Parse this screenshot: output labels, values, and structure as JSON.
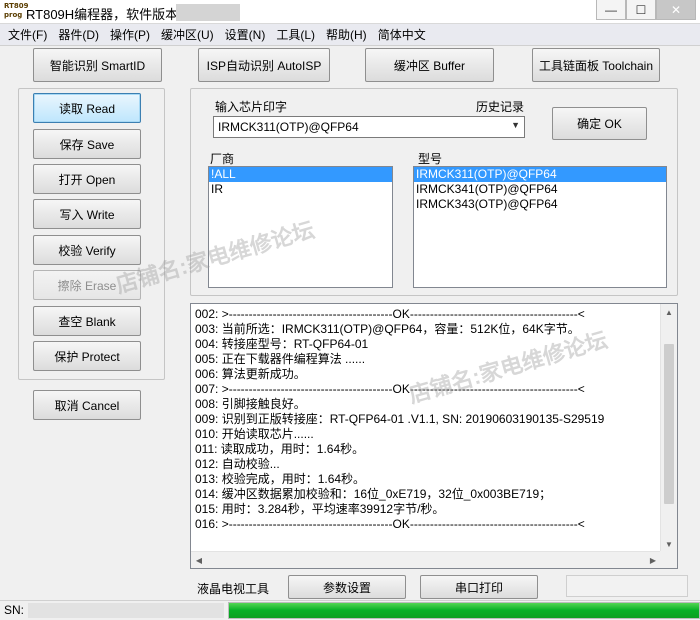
{
  "window": {
    "title": "RT809H编程器，软件版本：",
    "app_icon_text": "RT809 prog",
    "minimize_glyph": "—",
    "maximize_glyph": "☐",
    "close_glyph": "✕"
  },
  "menu": [
    "文件(F)",
    "器件(D)",
    "操作(P)",
    "缓冲区(U)",
    "设置(N)",
    "工具(L)",
    "帮助(H)",
    "简体中文"
  ],
  "top_buttons": {
    "smart_id": "智能识别 SmartID",
    "isp_auto": "ISP自动识别 AutoISP",
    "buffer": "缓冲区 Buffer",
    "toolchain": "工具链面板 Toolchain"
  },
  "side_buttons": {
    "read": "读取 Read",
    "save": "保存 Save",
    "open": "打开 Open",
    "write": "写入 Write",
    "verify": "校验 Verify",
    "erase": "擦除 Erase",
    "blank": "查空 Blank",
    "protect": "保护 Protect",
    "cancel": "取消 Cancel"
  },
  "chip": {
    "input_label": "输入芯片印字",
    "history_label": "历史记录",
    "value": "IRMCK311(OTP)@QFP64",
    "confirm": "确定 OK"
  },
  "vendor": {
    "label": "厂商",
    "items": [
      "!ALL",
      "IR"
    ],
    "selected_index": 0
  },
  "model": {
    "label": "型号",
    "items": [
      "IRMCK311(OTP)@QFP64",
      "IRMCK341(OTP)@QFP64",
      "IRMCK343(OTP)@QFP64"
    ],
    "selected_index": 0
  },
  "log": [
    "002: >-----------------------------------------OK------------------------------------------<",
    "003: 当前所选：IRMCK311(OTP)@QFP64，容量：512K位，64K字节。",
    "004: 转接座型号：RT-QFP64-01",
    "005: 正在下载器件编程算法 ......",
    "006: 算法更新成功。",
    "007: >-----------------------------------------OK------------------------------------------<",
    "008: 引脚接触良好。",
    "009: 识别到正版转接座：RT-QFP64-01 .V1.1, SN: 20190603190135-S29519",
    "010: 开始读取芯片......",
    "011: 读取成功，用时：1.64秒。",
    "012: 自动校验...",
    "013: 校验完成，用时：1.64秒。",
    "014: 缓冲区数据累加校验和：16位_0xE719，32位_0x003BE719；",
    "015: 用时：3.284秒，平均速率39912字节/秒。",
    "016: >-----------------------------------------OK------------------------------------------<"
  ],
  "bottom": {
    "lcd_tool": "液晶电视工具",
    "params": "参数设置",
    "serial_print": "串口打印"
  },
  "status": {
    "sn_label": "SN:",
    "progress_fraction": 1.0
  },
  "watermark": [
    "店铺名:家电维修论坛",
    "店铺名:家电维修论坛"
  ],
  "icons": {
    "combo_arrow": "▼",
    "scroll_up": "▲",
    "scroll_down": "▼",
    "scroll_left": "◀",
    "scroll_right": "▶"
  }
}
